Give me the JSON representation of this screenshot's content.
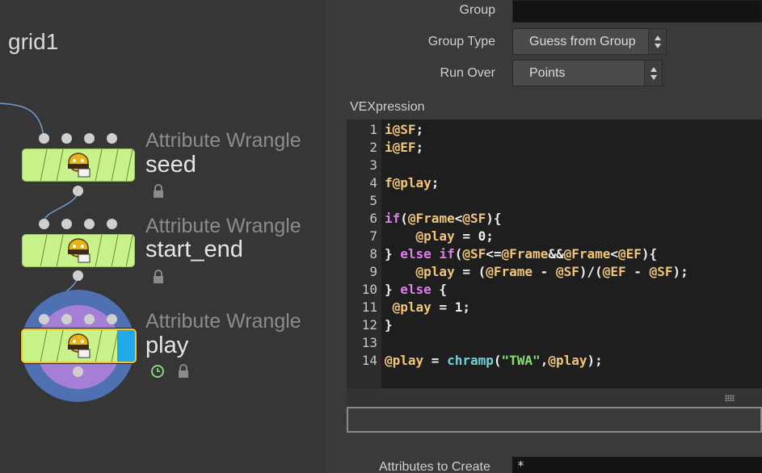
{
  "network": {
    "title": "grid1",
    "nodes": [
      {
        "type_label": "Attribute Wrangle",
        "name": "seed",
        "icon": "wrangle-icon",
        "flags": [
          "lock-icon"
        ]
      },
      {
        "type_label": "Attribute Wrangle",
        "name": "start_end",
        "icon": "wrangle-icon",
        "flags": [
          "lock-icon"
        ]
      },
      {
        "type_label": "Attribute Wrangle",
        "name": "play",
        "icon": "wrangle-icon",
        "flags": [
          "clock-icon",
          "lock-icon"
        ],
        "selected": true,
        "display_flag_color": "#1fa9e8"
      }
    ],
    "node_color": "#c8f28a",
    "highlight_colors": [
      "#4f71b3",
      "#a57fd6"
    ],
    "selection_color": "#f2c230"
  },
  "params": {
    "group": {
      "label": "Group",
      "value": ""
    },
    "group_type": {
      "label": "Group Type",
      "value": "Guess from Group"
    },
    "run_over": {
      "label": "Run Over",
      "value": "Points"
    },
    "vexpression": {
      "label": "VEXpression",
      "line_numbers": [
        "1",
        "2",
        "3",
        "4",
        "5",
        "6",
        "7",
        "8",
        "9",
        "10",
        "11",
        "12",
        "13",
        "14"
      ],
      "lines": [
        "i@SF;",
        "i@EF;",
        "",
        "f@play;",
        "",
        "if(@Frame<@SF){",
        "    @play = 0;",
        "} else if(@SF<=@Frame&&@Frame<@EF){",
        "    @play = (@Frame - @SF)/(@EF - @SF);",
        "} else {",
        " @play = 1;",
        "}",
        "",
        "@play = chramp(\"TWA\",@play);"
      ]
    },
    "attributes_to_create": {
      "label": "Attributes to Create",
      "value": "*"
    }
  }
}
